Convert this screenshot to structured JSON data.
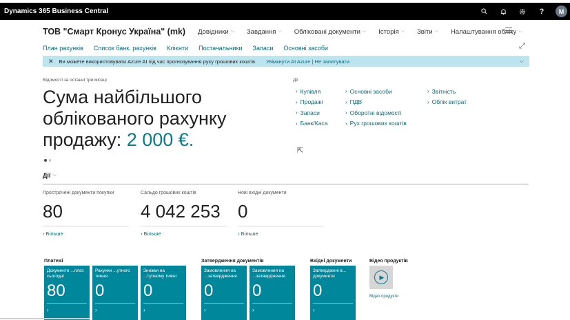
{
  "app": {
    "title": "Dynamics 365 Business Central",
    "avatar": "M"
  },
  "topbar_icons": [
    "search-icon",
    "bell-icon",
    "gear-icon",
    "help-icon"
  ],
  "company": "ТОВ \"Смарт Кронус Україна\" (mk)",
  "nav": [
    {
      "label": "Довідники"
    },
    {
      "label": "Завдання"
    },
    {
      "label": "Обліковані документи"
    },
    {
      "label": "Історія"
    },
    {
      "label": "Звіти"
    },
    {
      "label": "Налаштування обліку"
    }
  ],
  "links": [
    "План рахунків",
    "Список банк. рахунків",
    "Клієнти",
    "Постачальники",
    "Запаси",
    "Основні засоби"
  ],
  "notification": {
    "message": "Ви можете використовувати Azure AI під час прогнозування руху грошових коштів.",
    "actions": "Увімкнути AI Azure | Не запитувати"
  },
  "headline": {
    "caption": "Відомості за останні три місяці",
    "text": "Сума найбільшого облікованого рахунку продажу: ",
    "value": "2 000 €."
  },
  "actions": {
    "caption": "Дії",
    "columns": [
      [
        "Купівля",
        "Продажі",
        "Запаси",
        "Банк/Каса"
      ],
      [
        "Основні засоби",
        "ПДВ",
        "Оборотні відомості",
        "Рух грошових коштів"
      ],
      [
        "Звітність",
        "Облік витрат"
      ]
    ]
  },
  "dii": "Дії",
  "kpis": [
    {
      "caption": "Прострочені документи покупки",
      "value": "80",
      "more": "Більше"
    },
    {
      "caption": "Сальдо грошових коштів",
      "value": "4 042 253",
      "more": "Більше"
    },
    {
      "caption": "Нові вхідні документи",
      "value": "0",
      "more": "Більше"
    }
  ],
  "groups": [
    {
      "title": "Платежі",
      "tiles": [
        {
          "caption": "Документи ...плат. сьогодні",
          "value": "80"
        },
        {
          "caption": "Рахунки ...утного тижня",
          "value": "0"
        },
        {
          "caption": "Знижки на ...тупному тижні",
          "value": "0"
        }
      ]
    },
    {
      "title": "Затвердження документів",
      "tiles": [
        {
          "caption": "Замовлення на ...затвердження",
          "value": "0"
        },
        {
          "caption": "Замовлення на ...затвердження",
          "value": "0"
        }
      ]
    },
    {
      "title": "Вхідні документи",
      "tiles": [
        {
          "caption": "Затверджені в... документи",
          "value": "0"
        }
      ]
    }
  ],
  "video": {
    "title": "Відео продуктів",
    "label": "Відео продукти"
  }
}
